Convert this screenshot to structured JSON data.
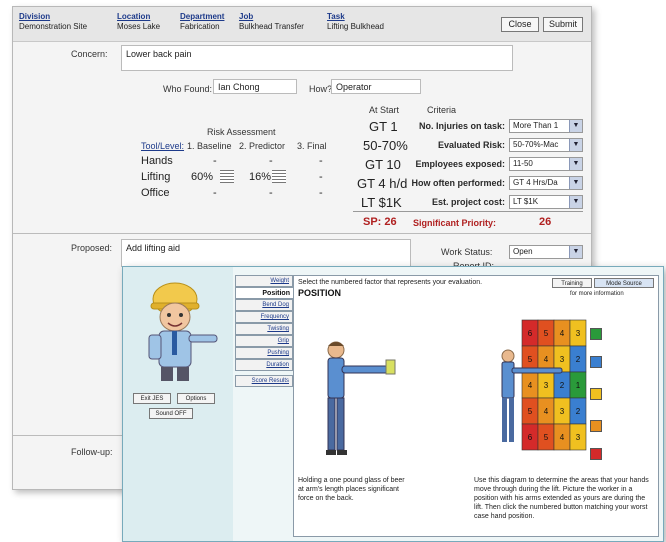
{
  "main_window": {
    "header": [
      {
        "label": "Division",
        "value": "Demonstration Site"
      },
      {
        "label": "Location",
        "value": "Moses Lake"
      },
      {
        "label": "Department",
        "value": "Fabrication"
      },
      {
        "label": "Job",
        "value": "Bulkhead Transfer"
      },
      {
        "label": "Task",
        "value": "Lifting Bulkhead"
      }
    ],
    "close_label": "Close",
    "submit_label": "Submit",
    "concern_label": "Concern:",
    "concern_value": "Lower back pain",
    "who_found_label": "Who Found:",
    "who_found_value": "Ian Chong",
    "how_label": "How?",
    "how_value": "Operator",
    "risk_title": "Risk Assessment",
    "tool_level_label": "Tool/Level:",
    "risk_columns": [
      "1. Baseline",
      "2. Predictor",
      "3. Final"
    ],
    "risk_rows": [
      {
        "name": "Hands",
        "baseline": "-",
        "predictor": "-",
        "final": "-"
      },
      {
        "name": "Lifting",
        "baseline": "60%",
        "predictor": "16%",
        "final": "-"
      },
      {
        "name": "Office",
        "baseline": "-",
        "predictor": "-",
        "final": "-"
      }
    ],
    "at_start_label": "At Start",
    "criteria_label": "Criteria",
    "criteria": [
      {
        "start": "GT 1",
        "label": "No. Injuries on task:",
        "value": "More Than 1"
      },
      {
        "start": "50-70%",
        "label": "Evaluated Risk:",
        "value": "50-70%-Mac"
      },
      {
        "start": "GT 10",
        "label": "Employees exposed:",
        "value": "11-50"
      },
      {
        "start": "GT 4 h/d",
        "label": "How often performed:",
        "value": "GT 4 Hrs/Da"
      },
      {
        "start": "LT $1K",
        "label": "Est. project cost:",
        "value": "LT $1K"
      }
    ],
    "sp_label": "SP: 26",
    "significant_priority_label": "Significant Priority:",
    "significant_priority_value": "26",
    "proposed_label": "Proposed:",
    "proposed_value": "Add lifting aid",
    "work_status_label": "Work Status:",
    "work_status_value": "Open",
    "report_label": "Report ID:",
    "follow_up_label": "Follow-up:"
  },
  "tool_window": {
    "left_buttons": [
      "Exit JES",
      "Options",
      "Sound OFF"
    ],
    "tabs": [
      "Weight",
      "Position",
      "Bend Dog",
      "Frequency",
      "Twisting",
      "Grip",
      "Pushing",
      "Duration",
      "Score Results"
    ],
    "active_tab": "Position",
    "instruction": "Select the numbered factor that represents your evaluation.",
    "title": "POSITION",
    "training_label": "Training",
    "more_info_label": "Mode Source",
    "more_info_sub": "for more information",
    "left_caption": "Holding a one pound glass of beer at arm's length places significant force on the back.",
    "right_caption": "Use this diagram to determine the areas that your hands move through during the lift. Picture the worker in a position with his arms extended as yours are during the lift. Then click the numbered button matching your worst case hand position.",
    "grid_numbers": [
      [
        "6",
        "5",
        "4",
        "3"
      ],
      [
        "5",
        "4",
        "3",
        "2"
      ],
      [
        "4",
        "3",
        "2",
        "1"
      ],
      [
        "5",
        "4",
        "3",
        "2"
      ],
      [
        "6",
        "5",
        "4",
        "3"
      ]
    ],
    "swatch_colors": [
      "#2a9a3a",
      "#3a7fd0",
      "#f0c020",
      "#e89020",
      "#d42a2a"
    ]
  }
}
